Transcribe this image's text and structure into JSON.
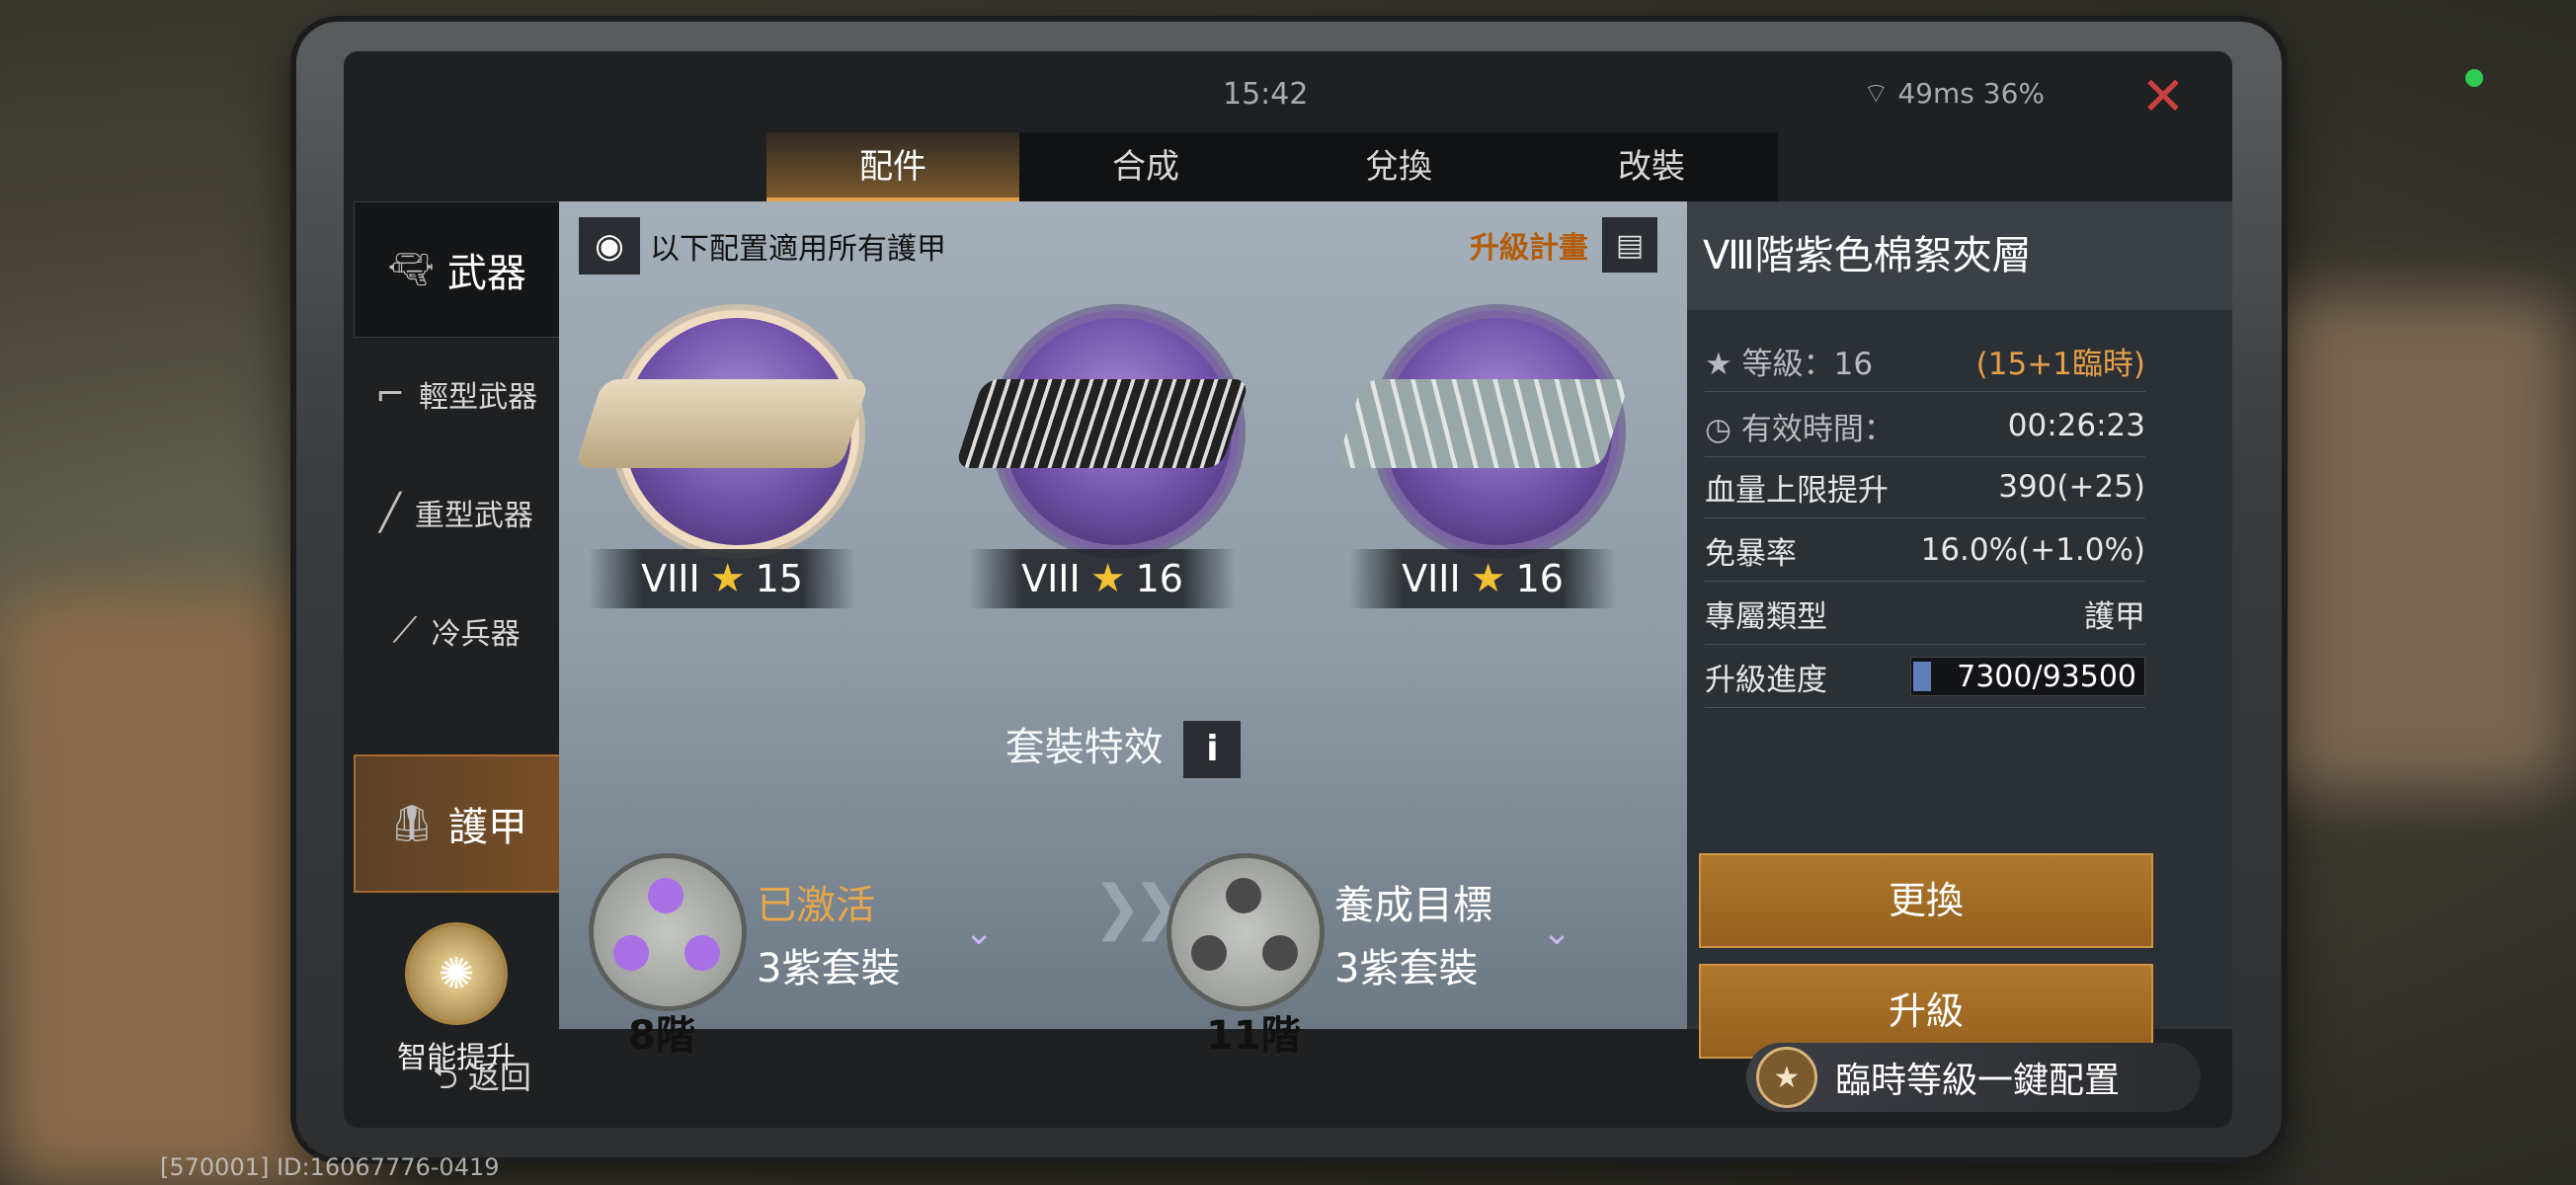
{
  "status": {
    "time": "15:42",
    "network": "49ms 36%"
  },
  "tabs": [
    {
      "label": "配件",
      "active": true
    },
    {
      "label": "合成",
      "active": false
    },
    {
      "label": "兌換",
      "active": false
    },
    {
      "label": "改裝",
      "active": false
    }
  ],
  "sidebar": {
    "items": [
      {
        "label": "武器",
        "icon": "pistol-icon"
      },
      {
        "label": "輕型武器",
        "icon": "smg-icon"
      },
      {
        "label": "重型武器",
        "icon": "launcher-icon"
      },
      {
        "label": "冷兵器",
        "icon": "knife-icon"
      },
      {
        "label": "護甲",
        "icon": "vest-icon",
        "active": true
      }
    ],
    "smart_upgrade": "智能提升"
  },
  "content": {
    "header": "以下配置適用所有護甲",
    "upgrade_plan": "升級計畫",
    "slots": [
      {
        "tier": "VIII",
        "stars": "15",
        "color": "#d7c8a7"
      },
      {
        "tier": "VIII",
        "stars": "16",
        "color": "#3e4144"
      },
      {
        "tier": "VIII",
        "stars": "16",
        "color": "#9fb0b0"
      }
    ],
    "set_title": "套裝特效",
    "info_label": "i",
    "sets": [
      {
        "status": "已激活",
        "desc": "3紫套裝",
        "stage": "8階"
      },
      {
        "status": "養成目標",
        "desc": "3紫套裝",
        "stage": "11階"
      }
    ]
  },
  "panel": {
    "title": "Ⅷ階紫色棉絮夾層",
    "level_label": "等級：16",
    "level_extra": "(15+1臨時)",
    "time_label": "有效時間：",
    "time_value": "00:26:23",
    "rows": [
      {
        "label": "血量上限提升",
        "value": "390(+25)"
      },
      {
        "label": "免暴率",
        "value": "16.0%(+1.0%)"
      },
      {
        "label": "專屬類型",
        "value": "護甲"
      }
    ],
    "progress_label": "升級進度",
    "progress_text": "7300/93500",
    "progress_fraction": 0.078,
    "replace_button": "更換",
    "upgrade_button": "升級"
  },
  "bottom": {
    "back": "返回",
    "quick_config": "臨時等級一鍵配置"
  },
  "footer": {
    "text": "[570001] ID:16067776-0419"
  }
}
